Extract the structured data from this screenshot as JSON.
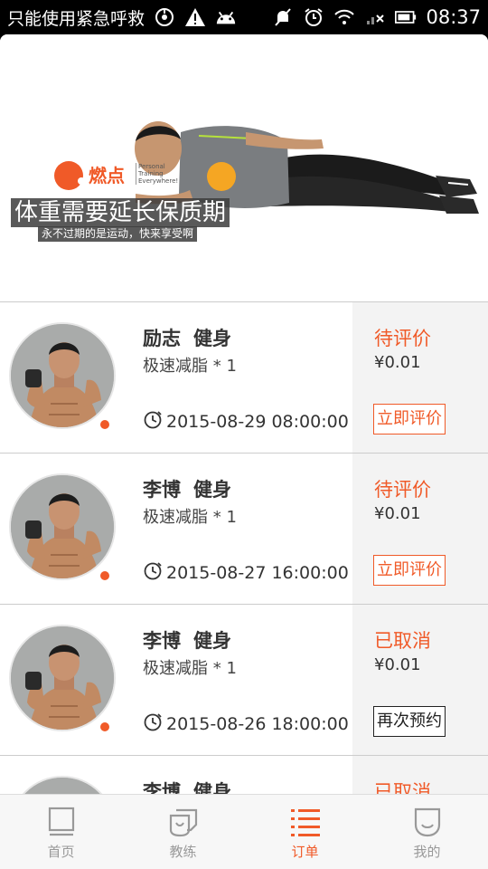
{
  "status_bar": {
    "carrier": "只能使用紧急呼救",
    "time": "08:37",
    "icons": [
      "hotspot-icon",
      "warning-icon",
      "android-icon",
      "mute-icon",
      "alarm-icon",
      "wifi-icon",
      "signal-icon",
      "battery-icon"
    ]
  },
  "banner": {
    "title": "体重需要延长保质期",
    "subtitle": "永不过期的是运动，快来享受啊",
    "brand": "燃点",
    "slogan": "Personal\nTraining\nEverywhere!"
  },
  "orders": [
    {
      "coach": "励志",
      "category": "健身",
      "course": "极速减脂 * 1",
      "datetime": "2015-08-29 08:00:00",
      "status": "待评价",
      "price": "¥0.01",
      "action": "立即评价",
      "action_style": "orange"
    },
    {
      "coach": "李博",
      "category": "健身",
      "course": "极速减脂 * 1",
      "datetime": "2015-08-27 16:00:00",
      "status": "待评价",
      "price": "¥0.01",
      "action": "立即评价",
      "action_style": "orange"
    },
    {
      "coach": "李博",
      "category": "健身",
      "course": "极速减脂 * 1",
      "datetime": "2015-08-26 18:00:00",
      "status": "已取消",
      "price": "¥0.01",
      "action": "再次预约",
      "action_style": "dark"
    },
    {
      "coach": "李博",
      "category": "健身",
      "course": "",
      "datetime": "",
      "status": "已取消",
      "price": "",
      "action": "",
      "action_style": "none"
    }
  ],
  "tabs": [
    {
      "label": "首页",
      "icon": "home-icon",
      "active": false
    },
    {
      "label": "教练",
      "icon": "coach-icon",
      "active": false
    },
    {
      "label": "订单",
      "icon": "orders-list-icon",
      "active": true
    },
    {
      "label": "我的",
      "icon": "profile-icon",
      "active": false
    }
  ],
  "colors": {
    "accent": "#f05a28",
    "tab_inactive": "#999999",
    "side_panel": "#f3f3f3"
  }
}
